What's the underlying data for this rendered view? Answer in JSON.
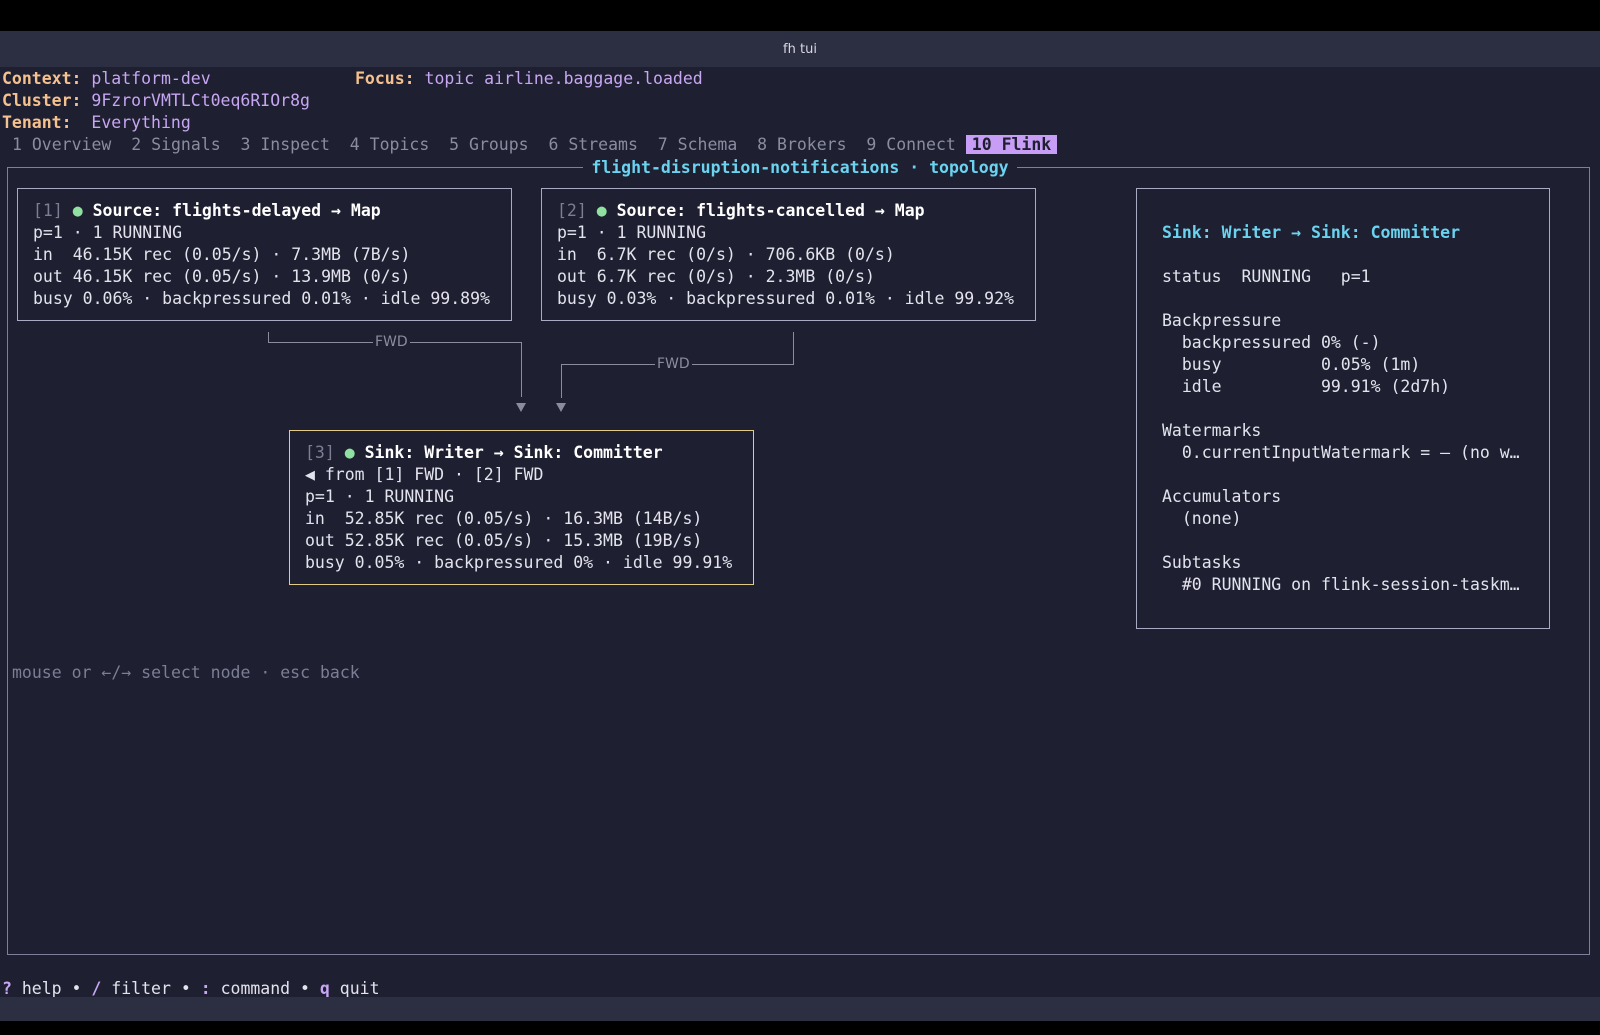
{
  "window": {
    "title": "fh tui"
  },
  "header": {
    "context_label": "Context:",
    "context_value": "platform-dev",
    "focus_label": "Focus:",
    "focus_value": "topic airline.baggage.loaded",
    "cluster_label": "Cluster:",
    "cluster_value": "9FzrorVMTLCt0eq6RIOr8g",
    "tenant_label": "Tenant:",
    "tenant_value": "Everything"
  },
  "tabs": [
    {
      "label": "1 Overview",
      "active": false
    },
    {
      "label": "2 Signals",
      "active": false
    },
    {
      "label": "3 Inspect",
      "active": false
    },
    {
      "label": "4 Topics",
      "active": false
    },
    {
      "label": "5 Groups",
      "active": false
    },
    {
      "label": "6 Streams",
      "active": false
    },
    {
      "label": "7 Schema",
      "active": false
    },
    {
      "label": "8 Brokers",
      "active": false
    },
    {
      "label": "9 Connect",
      "active": false
    },
    {
      "label": "10 Flink",
      "active": true
    }
  ],
  "panel": {
    "title": "flight-disruption-notifications · topology"
  },
  "nodes": [
    {
      "index": "[1]",
      "name": "Source: flights-delayed → Map",
      "status_line": "p=1 · 1 RUNNING",
      "in_line": "in  46.15K rec (0.05/s) · 7.3MB (7B/s)",
      "out_line": "out 46.15K rec (0.05/s) · 13.9MB (0/s)",
      "busy_line": "busy 0.06% · backpressured 0.01% · idle 99.89%"
    },
    {
      "index": "[2]",
      "name": "Source: flights-cancelled → Map",
      "status_line": "p=1 · 1 RUNNING",
      "in_line": "in  6.7K rec (0/s) · 706.6KB (0/s)",
      "out_line": "out 6.7K rec (0/s) · 2.3MB (0/s)",
      "busy_line": "busy 0.03% · backpressured 0.01% · idle 99.92%"
    },
    {
      "index": "[3]",
      "name": "Sink: Writer → Sink: Committer",
      "from_line": "◀ from [1] FWD · [2] FWD",
      "status_line": "p=1 · 1 RUNNING",
      "in_line": "in  52.85K rec (0.05/s) · 16.3MB (14B/s)",
      "out_line": "out 52.85K rec (0.05/s) · 15.3MB (19B/s)",
      "busy_line": "busy 0.05% · backpressured 0% · idle 99.91%"
    }
  ],
  "edges": [
    {
      "label": "FWD"
    },
    {
      "label": "FWD"
    }
  ],
  "detail": {
    "title": "Sink: Writer → Sink: Committer",
    "status_line": "status  RUNNING   p=1",
    "backpressure_heading": "Backpressure",
    "backpressured_line": "  backpressured 0% (-)",
    "busy_line": "  busy          0.05% (1m)",
    "idle_line": "  idle          99.91% (2d7h)",
    "watermarks_heading": "Watermarks",
    "watermark_line": "  0.currentInputWatermark = — (no w…",
    "accumulators_heading": "Accumulators",
    "accumulators_line": "  (none)",
    "subtasks_heading": "Subtasks",
    "subtask_line": "  #0 RUNNING on flink-session-taskm…"
  },
  "hint": "mouse or ←/→ select node · esc back",
  "footer": {
    "help_key": "?",
    "help_label": " help • ",
    "filter_key": "/",
    "filter_label": " filter • ",
    "command_key": ":",
    "command_label": " command • ",
    "quit_key": "q",
    "quit_label": " quit"
  },
  "colors": {
    "background": "#1e1f30",
    "label": "#f5c18e",
    "value": "#c7a6f2",
    "accent_cyan": "#6ad3f0",
    "running_dot": "#8fe0a1",
    "selected_border": "#e3cb86"
  }
}
